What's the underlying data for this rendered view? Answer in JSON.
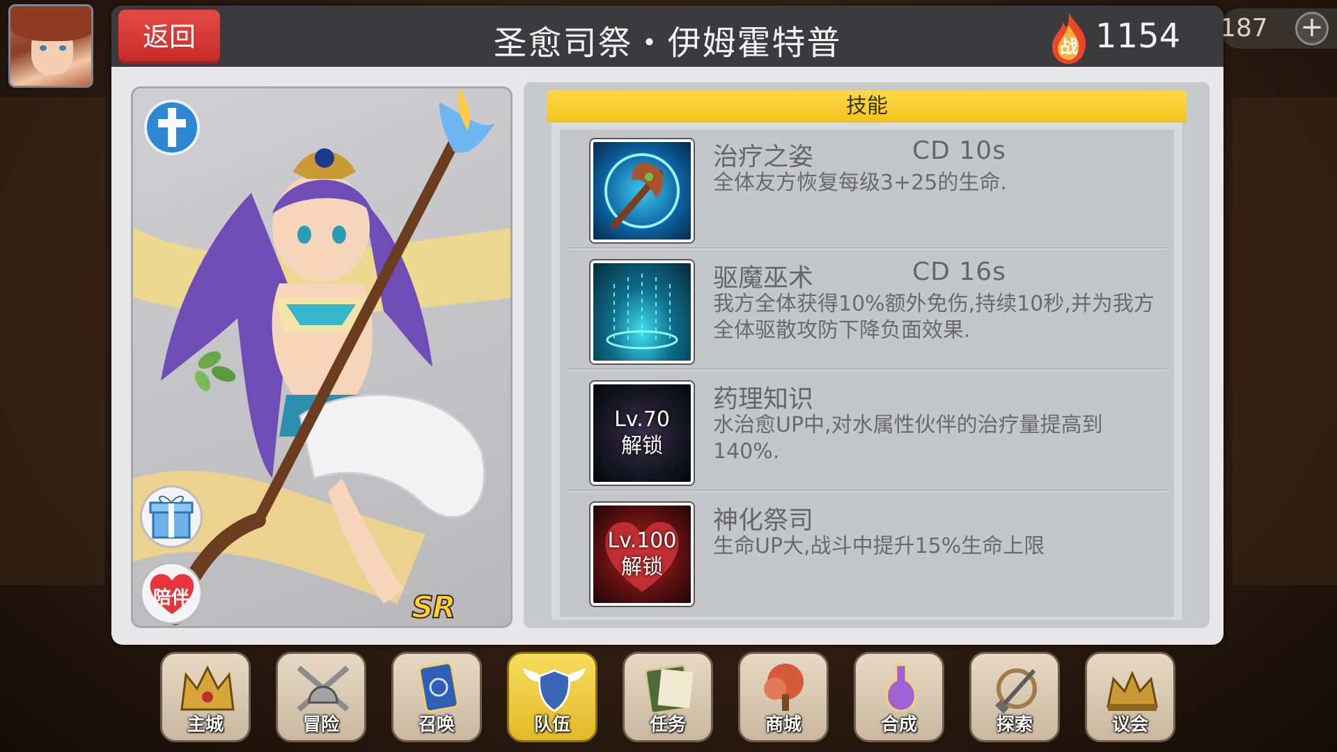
{
  "currency": {
    "value": "187"
  },
  "header": {
    "back_label": "返回",
    "title": "圣愈司祭・伊姆霍特普",
    "power_icon_label": "战",
    "power": "1154"
  },
  "card": {
    "rarity": "SR",
    "companion_label": "陪伴"
  },
  "skills": {
    "header": "技能",
    "items": [
      {
        "name": "治疗之姿",
        "cd": "CD  10s",
        "desc": "全体友方恢复每级3+25的生命.",
        "icon": "healing-staff-icon"
      },
      {
        "name": "驱魔巫术",
        "cd": "CD  16s",
        "desc": "我方全体获得10%额外免伤,持续10秒,并为我方全体驱散攻防下降负面效果.",
        "icon": "exorcism-magic-icon"
      },
      {
        "name": "药理知识",
        "cd": "",
        "desc": "水治愈UP中,对水属性伙伴的治疗量提高到140%.",
        "icon": "locked-skill-icon",
        "lock_level": "Lv.70",
        "lock_text": "解锁"
      },
      {
        "name": "神化祭司",
        "cd": "",
        "desc": "生命UP大,战斗中提升15%生命上限",
        "icon": "locked-heart-skill-icon",
        "lock_level": "Lv.100",
        "lock_text": "解锁"
      }
    ]
  },
  "nav": [
    {
      "label": "主城",
      "icon": "crown-icon"
    },
    {
      "label": "冒险",
      "icon": "helmet-swords-icon"
    },
    {
      "label": "召唤",
      "icon": "summon-card-icon"
    },
    {
      "label": "队伍",
      "icon": "winged-shield-icon",
      "active": true
    },
    {
      "label": "任务",
      "icon": "quest-book-icon"
    },
    {
      "label": "商城",
      "icon": "shop-tree-icon"
    },
    {
      "label": "合成",
      "icon": "potion-flask-icon"
    },
    {
      "label": "探索",
      "icon": "shovel-rope-icon"
    },
    {
      "label": "议会",
      "icon": "council-crown-icon"
    }
  ]
}
